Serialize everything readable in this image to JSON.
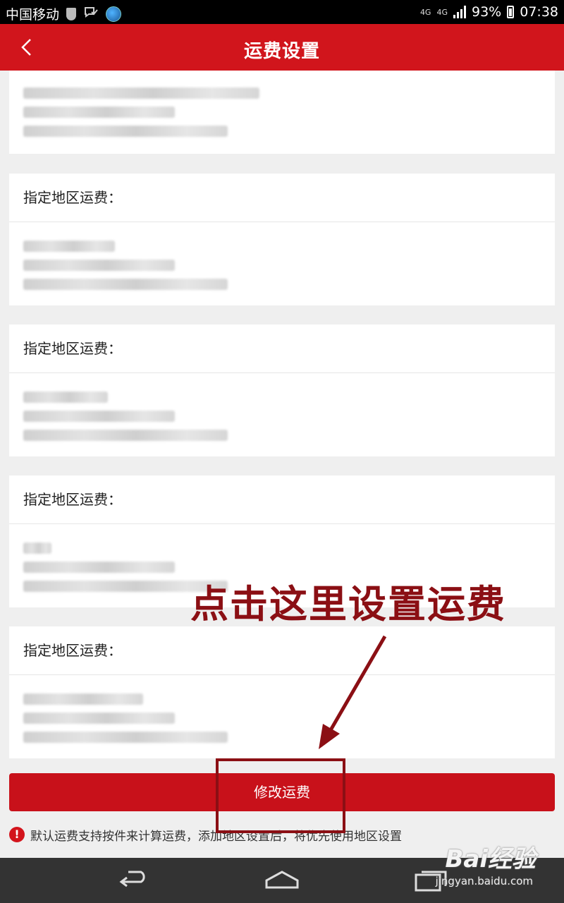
{
  "status_bar": {
    "carrier": "中国移动",
    "network_1": "4G",
    "network_2": "4G",
    "battery": "93%",
    "time": "07:38"
  },
  "header": {
    "title": "运费设置"
  },
  "cards": [
    {
      "header": "指定地区运费："
    },
    {
      "header": "指定地区运费："
    },
    {
      "header": "指定地区运费："
    },
    {
      "header": "指定地区运费："
    }
  ],
  "footer": {
    "modify_button": "修改运费",
    "note": "默认运费支持按件来计算运费，添加地区设置后，将优先使用地区设置"
  },
  "annotation": {
    "text": "点击这里设置运费"
  },
  "watermark": {
    "brand": "Bai经验",
    "url": "jingyan.baidu.com"
  }
}
